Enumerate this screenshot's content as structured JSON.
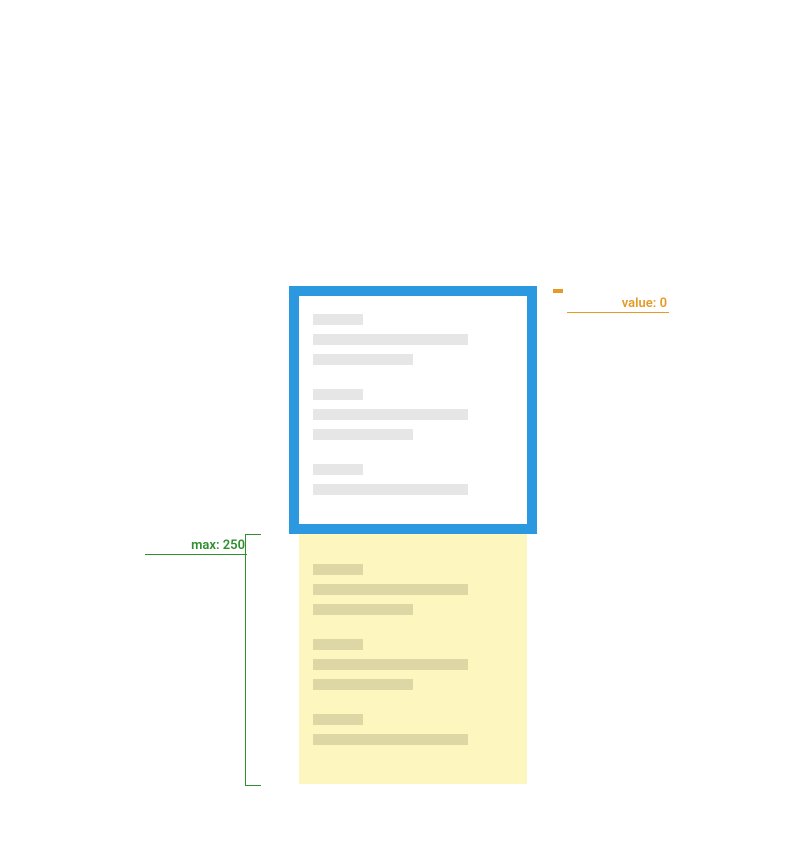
{
  "annotations": {
    "value_label": "value: 0",
    "max_label": "max: 250"
  },
  "colors": {
    "viewport_border": "#2b98e0",
    "overflow_bg": "#fdf6bf",
    "value_color": "#e69a28",
    "max_color": "#2f8f2f"
  },
  "geometry": {
    "viewport_size": 248,
    "overflow_height": 250
  }
}
